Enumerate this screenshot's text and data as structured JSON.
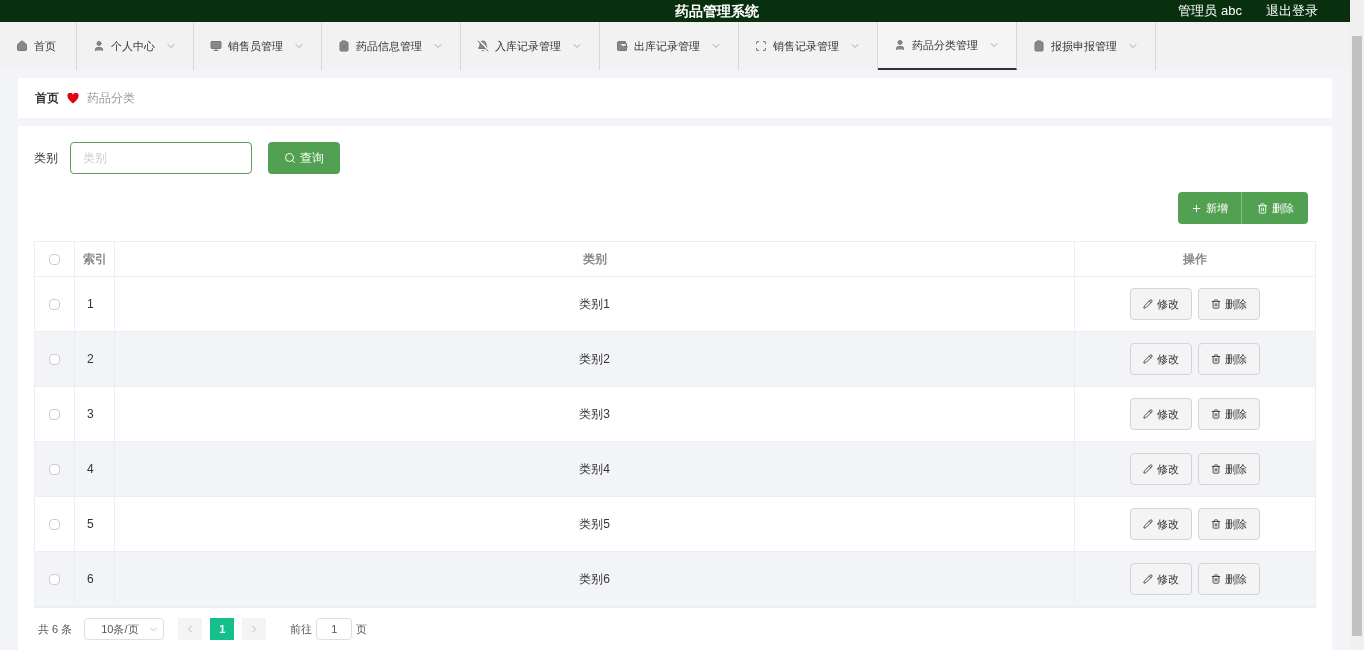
{
  "header": {
    "title": "药品管理系统",
    "user": "管理员 abc",
    "logout": "退出登录"
  },
  "nav": [
    {
      "label": "首页",
      "dropdown": false,
      "selected": false
    },
    {
      "label": "个人中心",
      "dropdown": true,
      "selected": false
    },
    {
      "label": "销售员管理",
      "dropdown": true,
      "selected": false
    },
    {
      "label": "药品信息管理",
      "dropdown": true,
      "selected": false
    },
    {
      "label": "入库记录管理",
      "dropdown": true,
      "selected": false
    },
    {
      "label": "出库记录管理",
      "dropdown": true,
      "selected": false
    },
    {
      "label": "销售记录管理",
      "dropdown": true,
      "selected": false
    },
    {
      "label": "药品分类管理",
      "dropdown": true,
      "selected": true
    },
    {
      "label": "报损申报管理",
      "dropdown": true,
      "selected": false
    }
  ],
  "breadcrumb": [
    "首页",
    "药品分类"
  ],
  "search": {
    "label": "类别",
    "placeholder": "类别",
    "button": "查询"
  },
  "actions": {
    "add": "新增",
    "delete": "删除"
  },
  "table": {
    "all_checked": false,
    "columns": [
      "索引",
      "类别",
      "操作"
    ],
    "rows": [
      {
        "index": "1",
        "category": "类别1",
        "edit": "修改",
        "delete": "删除",
        "checked": false
      },
      {
        "index": "2",
        "category": "类别2",
        "edit": "修改",
        "delete": "删除",
        "checked": false
      },
      {
        "index": "3",
        "category": "类别3",
        "edit": "修改",
        "delete": "删除",
        "checked": false
      },
      {
        "index": "4",
        "category": "类别4",
        "edit": "修改",
        "delete": "删除",
        "checked": false
      },
      {
        "index": "5",
        "category": "类别5",
        "edit": "修改",
        "delete": "删除",
        "checked": false
      },
      {
        "index": "6",
        "category": "类别6",
        "edit": "修改",
        "delete": "删除",
        "checked": false
      }
    ]
  },
  "pagination": {
    "total": "共 6 条",
    "page_size": "10条/页",
    "pages": [
      {
        "label": "1",
        "selected": true
      }
    ],
    "goto_label": "前往",
    "goto_value": "1",
    "goto_suffix": "页"
  }
}
